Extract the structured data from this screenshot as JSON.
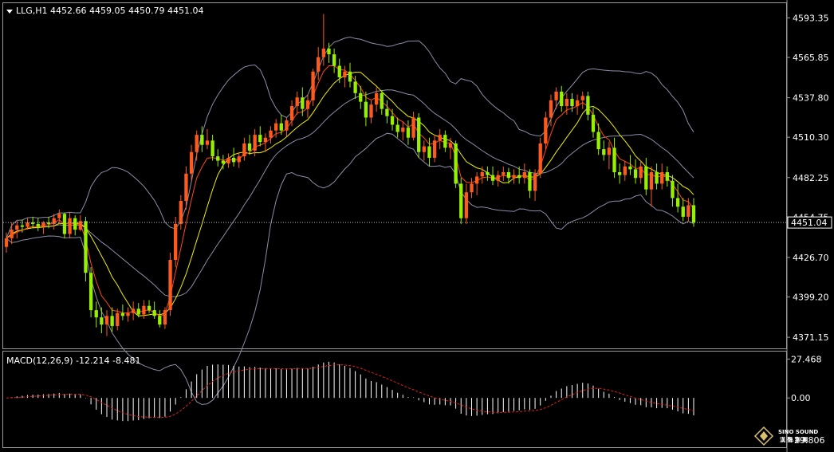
{
  "chart_data": [
    {
      "type": "candlestick",
      "title": "LLG,H1  4452.66 4459.05 4450.79 4451.04",
      "symbol": "LLG,H1",
      "ohlc_last": {
        "open": "4452.66",
        "high": "4459.05",
        "low": "4450.79",
        "close": "4451.04"
      },
      "current_price_label": "4451.04",
      "y_tick_labels": [
        "4593.35",
        "4565.85",
        "4537.80",
        "4510.30",
        "4482.25",
        "4454.75",
        "4426.70",
        "4399.20",
        "4371.15"
      ],
      "ylim": [
        4364.0,
        4603.0
      ],
      "colors": {
        "up": "#ff5a1e",
        "down": "#96f000",
        "bollinger": "#8a8fa6",
        "ma_fast": "#ff4a12",
        "ma_slow": "#f0f000",
        "price_line": "#c0c0c0"
      },
      "legend": "none",
      "grid": false,
      "candles": [
        [
          4434,
          4444,
          4430,
          4440
        ],
        [
          4440,
          4451,
          4436,
          4446
        ],
        [
          4446,
          4452,
          4440,
          4449
        ],
        [
          4449,
          4453,
          4444,
          4448
        ],
        [
          4448,
          4454,
          4446,
          4451
        ],
        [
          4451,
          4455,
          4447,
          4450
        ],
        [
          4450,
          4454,
          4445,
          4448
        ],
        [
          4448,
          4452,
          4443,
          4451
        ],
        [
          4451,
          4455,
          4447,
          4450
        ],
        [
          4450,
          4457,
          4446,
          4454
        ],
        [
          4454,
          4460,
          4450,
          4457
        ],
        [
          4457,
          4458,
          4440,
          4443
        ],
        [
          4443,
          4458,
          4440,
          4454
        ],
        [
          4454,
          4456,
          4442,
          4446
        ],
        [
          4446,
          4456,
          4445,
          4452
        ],
        [
          4452,
          4455,
          4410,
          4416
        ],
        [
          4416,
          4420,
          4385,
          4390
        ],
        [
          4390,
          4396,
          4378,
          4385
        ],
        [
          4385,
          4392,
          4374,
          4380
        ],
        [
          4380,
          4390,
          4372,
          4386
        ],
        [
          4386,
          4392,
          4375,
          4379
        ],
        [
          4379,
          4391,
          4376,
          4388
        ],
        [
          4388,
          4394,
          4383,
          4386
        ],
        [
          4386,
          4392,
          4382,
          4388
        ],
        [
          4388,
          4396,
          4383,
          4391
        ],
        [
          4391,
          4395,
          4385,
          4387
        ],
        [
          4387,
          4397,
          4384,
          4393
        ],
        [
          4393,
          4397,
          4388,
          4390
        ],
        [
          4390,
          4396,
          4384,
          4386
        ],
        [
          4386,
          4390,
          4378,
          4380
        ],
        [
          4380,
          4392,
          4377,
          4390
        ],
        [
          4390,
          4430,
          4386,
          4425
        ],
        [
          4425,
          4455,
          4420,
          4450
        ],
        [
          4450,
          4470,
          4446,
          4466
        ],
        [
          4466,
          4490,
          4460,
          4485
        ],
        [
          4485,
          4505,
          4480,
          4500
        ],
        [
          4500,
          4515,
          4494,
          4512
        ],
        [
          4512,
          4518,
          4500,
          4505
        ],
        [
          4505,
          4516,
          4502,
          4508
        ],
        [
          4508,
          4512,
          4494,
          4497
        ],
        [
          4497,
          4502,
          4490,
          4494
        ],
        [
          4494,
          4498,
          4488,
          4492
        ],
        [
          4492,
          4499,
          4489,
          4496
        ],
        [
          4496,
          4503,
          4490,
          4493
        ],
        [
          4493,
          4500,
          4489,
          4497
        ],
        [
          4497,
          4510,
          4494,
          4506
        ],
        [
          4506,
          4512,
          4498,
          4501
        ],
        [
          4501,
          4516,
          4497,
          4512
        ],
        [
          4512,
          4518,
          4504,
          4507
        ],
        [
          4507,
          4513,
          4500,
          4510
        ],
        [
          4510,
          4518,
          4506,
          4515
        ],
        [
          4515,
          4523,
          4510,
          4520
        ],
        [
          4520,
          4526,
          4512,
          4515
        ],
        [
          4515,
          4524,
          4511,
          4522
        ],
        [
          4522,
          4536,
          4518,
          4532
        ],
        [
          4532,
          4542,
          4526,
          4538
        ],
        [
          4538,
          4545,
          4525,
          4530
        ],
        [
          4530,
          4540,
          4524,
          4536
        ],
        [
          4536,
          4558,
          4532,
          4556
        ],
        [
          4556,
          4573,
          4550,
          4566
        ],
        [
          4566,
          4596,
          4560,
          4572
        ],
        [
          4572,
          4576,
          4562,
          4568
        ],
        [
          4568,
          4572,
          4555,
          4560
        ],
        [
          4560,
          4565,
          4548,
          4552
        ],
        [
          4552,
          4560,
          4545,
          4556
        ],
        [
          4556,
          4562,
          4545,
          4549
        ],
        [
          4549,
          4553,
          4537,
          4541
        ],
        [
          4541,
          4546,
          4530,
          4535
        ],
        [
          4535,
          4542,
          4518,
          4524
        ],
        [
          4524,
          4536,
          4520,
          4533
        ],
        [
          4533,
          4545,
          4528,
          4541
        ],
        [
          4541,
          4543,
          4526,
          4530
        ],
        [
          4530,
          4536,
          4520,
          4525
        ],
        [
          4525,
          4530,
          4515,
          4519
        ],
        [
          4519,
          4524,
          4510,
          4514
        ],
        [
          4514,
          4521,
          4508,
          4517
        ],
        [
          4517,
          4522,
          4505,
          4510
        ],
        [
          4510,
          4528,
          4508,
          4524
        ],
        [
          4524,
          4527,
          4496,
          4500
        ],
        [
          4500,
          4508,
          4494,
          4504
        ],
        [
          4504,
          4510,
          4490,
          4496
        ],
        [
          4496,
          4512,
          4493,
          4508
        ],
        [
          4508,
          4516,
          4502,
          4512
        ],
        [
          4512,
          4515,
          4500,
          4503
        ],
        [
          4503,
          4510,
          4495,
          4506
        ],
        [
          4506,
          4508,
          4475,
          4478
        ],
        [
          4478,
          4482,
          4450,
          4454
        ],
        [
          4454,
          4478,
          4450,
          4472
        ],
        [
          4472,
          4482,
          4468,
          4478
        ],
        [
          4478,
          4486,
          4470,
          4483
        ],
        [
          4483,
          4490,
          4478,
          4486
        ],
        [
          4486,
          4490,
          4480,
          4484
        ],
        [
          4484,
          4490,
          4477,
          4480
        ],
        [
          4480,
          4487,
          4476,
          4484
        ],
        [
          4484,
          4490,
          4480,
          4486
        ],
        [
          4486,
          4489,
          4478,
          4482
        ],
        [
          4482,
          4488,
          4478,
          4484
        ],
        [
          4484,
          4490,
          4478,
          4482
        ],
        [
          4482,
          4492,
          4478,
          4486
        ],
        [
          4486,
          4488,
          4468,
          4473
        ],
        [
          4473,
          4488,
          4466,
          4485
        ],
        [
          4485,
          4510,
          4482,
          4506
        ],
        [
          4506,
          4528,
          4502,
          4524
        ],
        [
          4524,
          4540,
          4518,
          4536
        ],
        [
          4536,
          4545,
          4530,
          4542
        ],
        [
          4542,
          4546,
          4528,
          4532
        ],
        [
          4532,
          4541,
          4526,
          4537
        ],
        [
          4537,
          4541,
          4528,
          4532
        ],
        [
          4532,
          4540,
          4526,
          4536
        ],
        [
          4536,
          4542,
          4530,
          4539
        ],
        [
          4539,
          4542,
          4522,
          4526
        ],
        [
          4526,
          4531,
          4510,
          4514
        ],
        [
          4514,
          4520,
          4498,
          4502
        ],
        [
          4502,
          4508,
          4494,
          4498
        ],
        [
          4498,
          4507,
          4488,
          4503
        ],
        [
          4503,
          4510,
          4482,
          4486
        ],
        [
          4486,
          4492,
          4478,
          4484
        ],
        [
          4484,
          4494,
          4480,
          4490
        ],
        [
          4490,
          4498,
          4484,
          4488
        ],
        [
          4488,
          4495,
          4478,
          4482
        ],
        [
          4482,
          4494,
          4478,
          4490
        ],
        [
          4490,
          4496,
          4470,
          4474
        ],
        [
          4474,
          4490,
          4462,
          4486
        ],
        [
          4486,
          4492,
          4474,
          4478
        ],
        [
          4478,
          4492,
          4474,
          4486
        ],
        [
          4486,
          4490,
          4476,
          4480
        ],
        [
          4480,
          4484,
          4462,
          4468
        ],
        [
          4468,
          4478,
          4458,
          4462
        ],
        [
          4462,
          4468,
          4452,
          4455
        ],
        [
          4455,
          4468,
          4452,
          4463
        ],
        [
          4463,
          4468,
          4448,
          4451
        ]
      ]
    },
    {
      "type": "histogram",
      "title": "MACD(12,26,9) -12.214 -8.481",
      "y_tick_labels": [
        "27.468",
        "0.00",
        "-29.806"
      ],
      "ylim": [
        -32.0,
        30.5
      ],
      "colors": {
        "bars": "#ffffff",
        "signal": "#e01e1e"
      }
    }
  ],
  "watermark": {
    "brand": "SINO SOUND",
    "sub": "漢 聲 集 團"
  }
}
